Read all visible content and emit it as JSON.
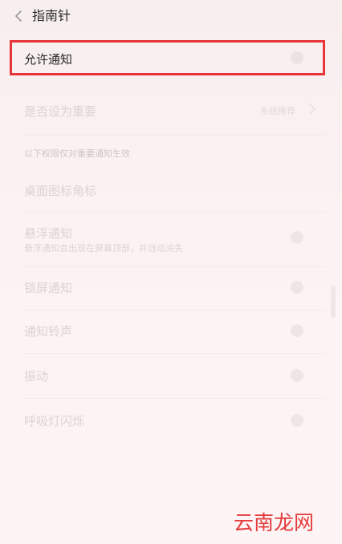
{
  "header": {
    "title": "指南针"
  },
  "rows": {
    "allow_notification": {
      "label": "允许通知"
    },
    "set_important": {
      "label": "是否设为重要",
      "value": "系统推荐"
    },
    "section_note": "以下权限仅对重要通知生效",
    "desktop_badge": {
      "label": "桌面图标角标"
    },
    "floating": {
      "label": "悬浮通知",
      "sub": "悬浮通知会出现在屏幕顶部，并自动消失"
    },
    "lockscreen": {
      "label": "锁屏通知"
    },
    "ringtone": {
      "label": "通知铃声"
    },
    "vibration": {
      "label": "振动"
    },
    "breathing_light": {
      "label": "呼吸灯闪烁"
    }
  },
  "watermark": "云南龙网",
  "colors": {
    "highlight_border": "#e8353a",
    "watermark": "#e53b3b",
    "background": "#f9f0f0"
  }
}
